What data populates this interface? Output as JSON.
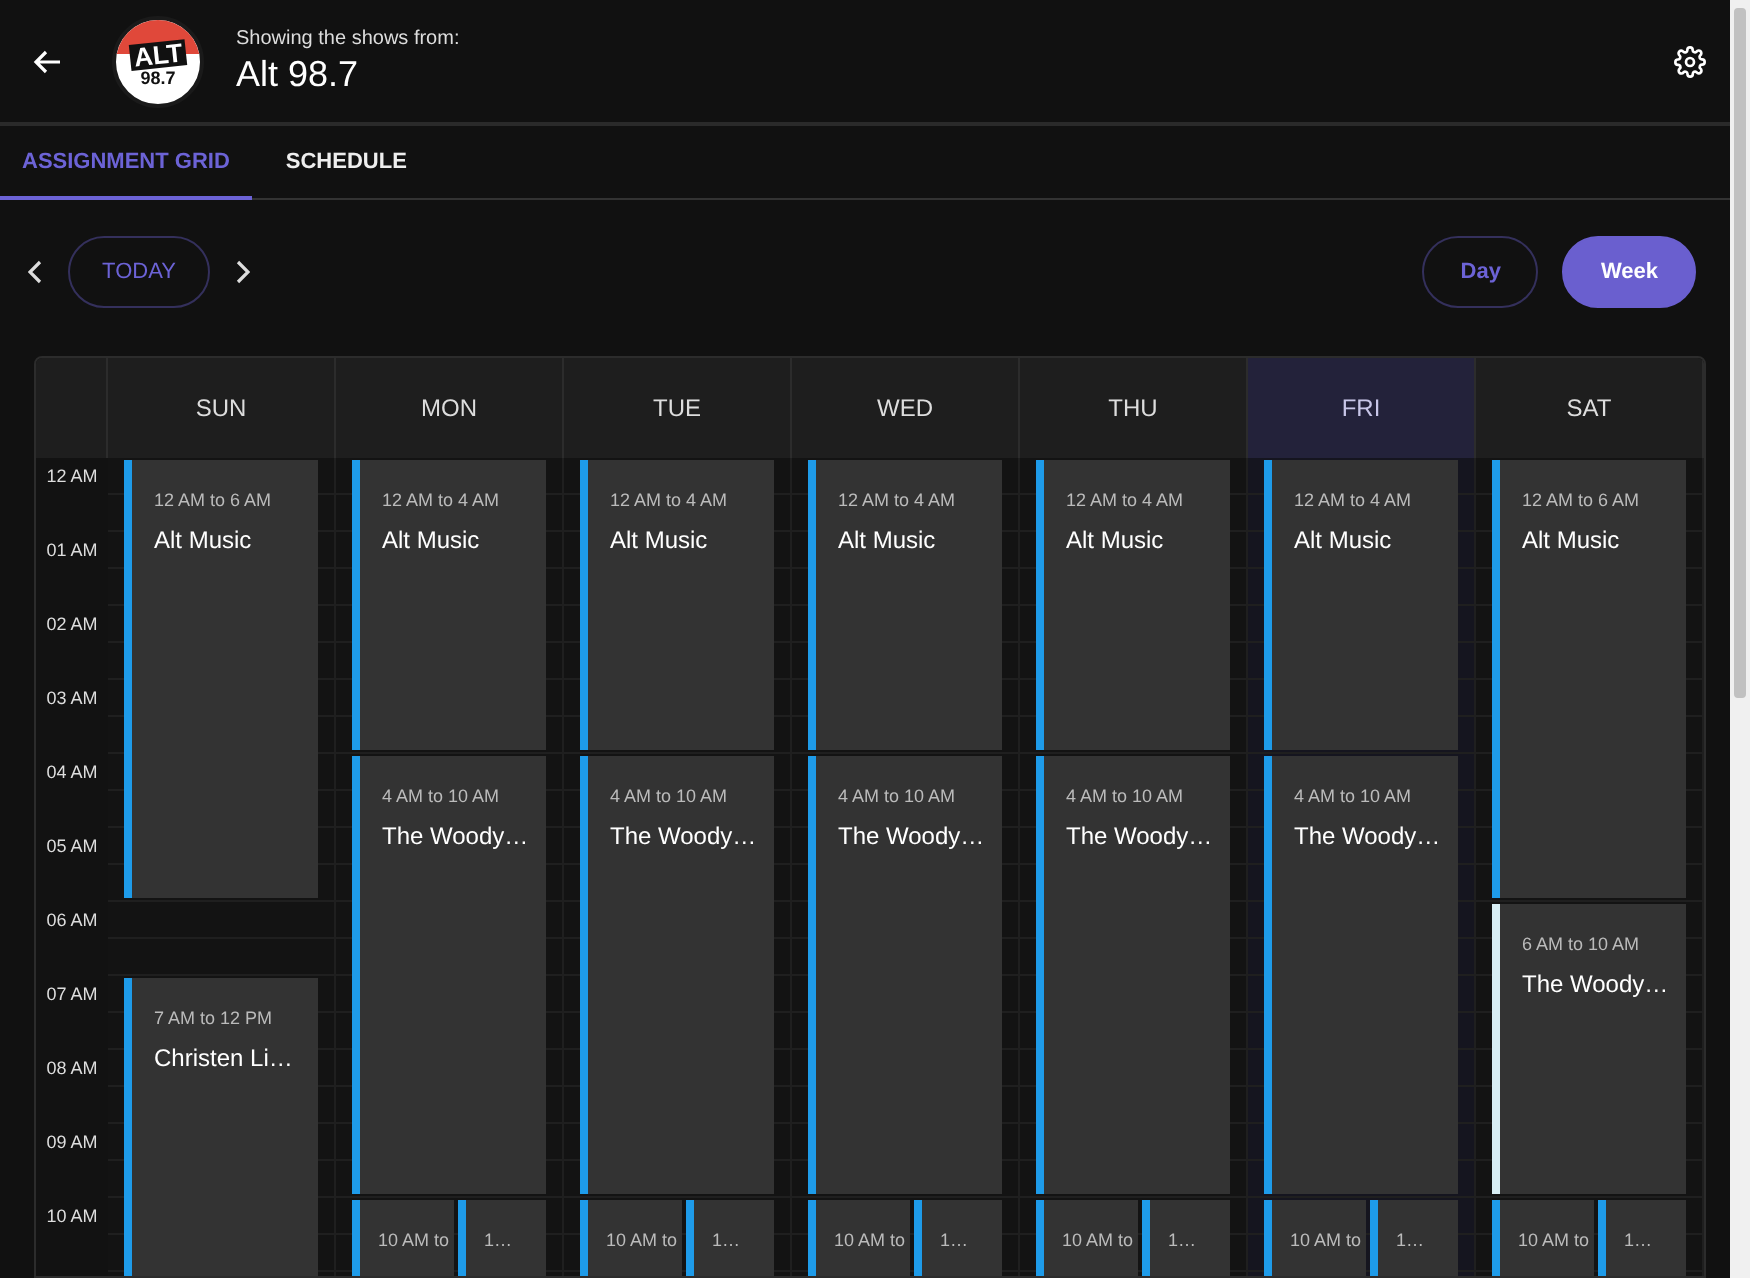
{
  "header": {
    "subtitle": "Showing the shows from:",
    "title": "Alt 98.7",
    "logo": {
      "word": "ALT",
      "number": "98.7"
    }
  },
  "tabs": [
    {
      "label": "ASSIGNMENT GRID",
      "selected": true
    },
    {
      "label": "SCHEDULE",
      "selected": false
    }
  ],
  "toolbar": {
    "today": "TODAY",
    "views": [
      {
        "label": "Day",
        "selected": false
      },
      {
        "label": "Week",
        "selected": true
      }
    ]
  },
  "hours": [
    "12 AM",
    "01 AM",
    "02 AM",
    "03 AM",
    "04 AM",
    "05 AM",
    "06 AM",
    "07 AM",
    "08 AM",
    "09 AM",
    "10 AM"
  ],
  "days": [
    {
      "label": "SUN",
      "selected": false,
      "events": [
        {
          "kind": "single",
          "time": "12 AM to 6 AM",
          "title": "Alt Music",
          "color": "#1e9be9"
        },
        {
          "kind": "single",
          "time": "7 AM to 12 PM",
          "title": "Christen Li…",
          "color": "#1e9be9"
        }
      ]
    },
    {
      "label": "MON",
      "selected": false,
      "events": [
        {
          "kind": "single",
          "time": "12 AM to 4 AM",
          "title": "Alt Music",
          "color": "#1e9be9"
        },
        {
          "kind": "single",
          "time": "4 AM to 10 AM",
          "title": "The Woody…",
          "color": "#1e9be9"
        },
        {
          "kind": "split",
          "parts": [
            {
              "time": "10 AM to",
              "color": "#1e9be9"
            },
            {
              "time": "1…",
              "color": "#1e9be9"
            }
          ]
        }
      ]
    },
    {
      "label": "TUE",
      "selected": false,
      "events": [
        {
          "kind": "single",
          "time": "12 AM to 4 AM",
          "title": "Alt Music",
          "color": "#1e9be9"
        },
        {
          "kind": "single",
          "time": "4 AM to 10 AM",
          "title": "The Woody…",
          "color": "#1e9be9"
        },
        {
          "kind": "split",
          "parts": [
            {
              "time": "10 AM to",
              "color": "#1e9be9"
            },
            {
              "time": "1…",
              "color": "#1e9be9"
            }
          ]
        }
      ]
    },
    {
      "label": "WED",
      "selected": false,
      "events": [
        {
          "kind": "single",
          "time": "12 AM to 4 AM",
          "title": "Alt Music",
          "color": "#1e9be9"
        },
        {
          "kind": "single",
          "time": "4 AM to 10 AM",
          "title": "The Woody…",
          "color": "#1e9be9"
        },
        {
          "kind": "split",
          "parts": [
            {
              "time": "10 AM to",
              "color": "#1e9be9"
            },
            {
              "time": "1…",
              "color": "#1e9be9"
            }
          ]
        }
      ]
    },
    {
      "label": "THU",
      "selected": false,
      "events": [
        {
          "kind": "single",
          "time": "12 AM to 4 AM",
          "title": "Alt Music",
          "color": "#1e9be9"
        },
        {
          "kind": "single",
          "time": "4 AM to 10 AM",
          "title": "The Woody…",
          "color": "#1e9be9"
        },
        {
          "kind": "split",
          "parts": [
            {
              "time": "10 AM to",
              "color": "#1e9be9"
            },
            {
              "time": "1…",
              "color": "#1e9be9"
            }
          ]
        }
      ]
    },
    {
      "label": "FRI",
      "selected": true,
      "events": [
        {
          "kind": "single",
          "time": "12 AM to 4 AM",
          "title": "Alt Music",
          "color": "#1e9be9"
        },
        {
          "kind": "single",
          "time": "4 AM to 10 AM",
          "title": "The Woody…",
          "color": "#1e9be9"
        },
        {
          "kind": "split",
          "parts": [
            {
              "time": "10 AM to",
              "color": "#1e9be9"
            },
            {
              "time": "1…",
              "color": "#1e9be9"
            }
          ]
        }
      ]
    },
    {
      "label": "SAT",
      "selected": false,
      "events": [
        {
          "kind": "single",
          "time": "12 AM to 6 AM",
          "title": "Alt Music",
          "color": "#1e9be9"
        },
        {
          "kind": "single",
          "time": "6 AM to 10 AM",
          "title": "The Woody…",
          "color": "#d8eef5"
        },
        {
          "kind": "split",
          "parts": [
            {
              "time": "10 AM to",
              "color": "#1e9be9"
            },
            {
              "time": "1…",
              "color": "#1e9be9"
            }
          ]
        }
      ]
    }
  ]
}
